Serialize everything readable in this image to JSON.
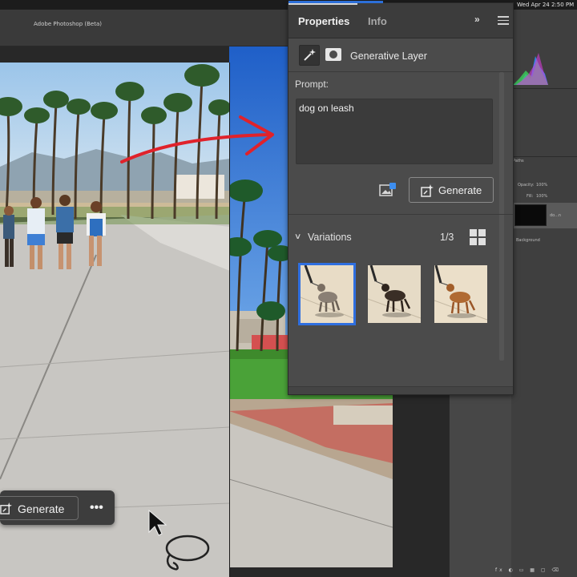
{
  "app": {
    "title": "Adobe Photoshop (Beta)",
    "clock": "Wed Apr 24  2:50 PM"
  },
  "properties_panel": {
    "tabs": [
      {
        "label": "Properties",
        "active": true
      },
      {
        "label": "Info",
        "active": false
      }
    ],
    "layer_type": "Generative Layer",
    "prompt_label": "Prompt:",
    "prompt_value": "dog on leash",
    "generate_label": "Generate",
    "variations_label": "Variations",
    "variations_count": "1/3",
    "selected_variation": 1,
    "accent_color": "#2f6fe0"
  },
  "floating_bar": {
    "generate_label": "Generate",
    "more_label": "•••"
  },
  "right_dock": {
    "opacity_label": "Opacity:",
    "opacity_value": "100%",
    "fill_label": "Fill:",
    "fill_value": "100%",
    "layer_name": "do...n",
    "background_layer": "Background",
    "paths_label": "Paths",
    "bottom_icons": "fx ◐ ▭ ▦ ▢ ⌫"
  },
  "annotation": {
    "arrow_color": "#e0222b"
  }
}
